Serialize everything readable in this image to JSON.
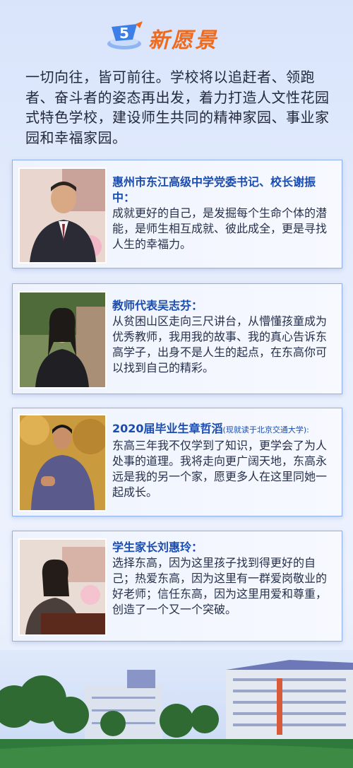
{
  "header": {
    "badge_number": "5",
    "title": "新愿景"
  },
  "intro": "一切向往，皆可前往。学校将以追赶者、领跑者、奋斗者的姿态再出发，着力打造人文性花园式特色学校，建设师生共同的精神家园、事业家园和幸福家园。",
  "cards": [
    {
      "name": "惠州市东江高级中学党委书记、校长谢振中：",
      "note": "",
      "quote": "成就更好的自己，是发掘每个生命个体的潜能，是师生相互成就、彼此成全，更是寻找人生的幸福力。"
    },
    {
      "name": "教师代表吴志芬：",
      "note": "",
      "quote": "从贫困山区走向三尺讲台，从懵懂孩童成为优秀教师，我用我的故事、我的真心告诉东高学子，出身不是人生的起点，在东高你可以找到自己的精彩。"
    },
    {
      "name": "2020届毕业生章哲滔",
      "note": "(现就读于北京交通大学):",
      "quote": "东高三年我不仅学到了知识，更学会了为人处事的道理。我将走向更广阔天地，东高永远是我的另一个家，愿更多人在这里同她一起成长。"
    },
    {
      "name": "学生家长刘惠玲：",
      "note": "",
      "quote": "选择东高，因为这里孩子找到得更好的自己；热爱东高，因为这里有一群爱岗敬业的好老师；信任东高，因为这里用爱和尊重，创造了一个又一个突破。"
    }
  ]
}
